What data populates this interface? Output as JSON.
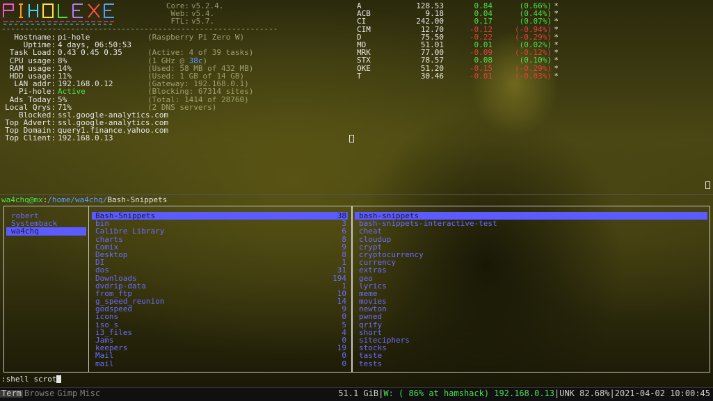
{
  "conky": {
    "logo_text": "PiHole",
    "versions": [
      {
        "label": "Core:",
        "value": "v5.2.4."
      },
      {
        "label": "Web:",
        "value": "v5.4."
      },
      {
        "label": "FTL:",
        "value": "v5.7."
      }
    ],
    "rule": "------------------------------------------------------------------",
    "rows": [
      {
        "key": "Hostname:",
        "value": "pi-hole",
        "note": "(Raspberry Pi Zero W)"
      },
      {
        "key": "Uptime:",
        "value": "4 days, 06:50:53",
        "note": ""
      },
      {
        "key": "Task Load:",
        "value": "0.43 0.45 0.35",
        "note": "(Active: 4 of 39 tasks)"
      },
      {
        "key": "CPU usage:",
        "value": "8%",
        "note_pre": "(1 GHz @ ",
        "note_hl": "38c",
        "note_post": ")"
      },
      {
        "key": "RAM usage:",
        "value": "14%",
        "note": "(Used: 58 MB of 432 MB)"
      },
      {
        "key": "HDD usage:",
        "value": "11%",
        "note": "(Used: 1 GB of 14 GB)"
      },
      {
        "key": "LAN addr:",
        "value": "192.168.0.12",
        "note": "(Gateway: 192.168.0.1)"
      },
      {
        "key": "Pi-hole:",
        "value": "Active",
        "note": "(Blocking: 67314 sites)"
      },
      {
        "key": "Ads Today:",
        "value": "5%",
        "note": "(Total: 1414 of 28760)"
      },
      {
        "key": "Local Qrys:",
        "value": "71%",
        "note": "(2 DNS servers)"
      },
      {
        "key": "Blocked:",
        "value": "ssl.google-analytics.com",
        "note": ""
      },
      {
        "key": "Top Advert:",
        "value": "ssl.google-analytics.com",
        "note": ""
      },
      {
        "key": "Top Domain:",
        "value": "query1.finance.yahoo.com",
        "note": ""
      },
      {
        "key": "Top Client:",
        "value": "192.168.0.13",
        "note": ""
      }
    ]
  },
  "stocks": [
    {
      "sym": "A",
      "price": "128.53",
      "chg": "0.84",
      "pct": "(0.66%)",
      "dir": "up"
    },
    {
      "sym": "ACB",
      "price": "9.18",
      "chg": "0.04",
      "pct": "(0.44%)",
      "dir": "up"
    },
    {
      "sym": "CI",
      "price": "242.00",
      "chg": "0.17",
      "pct": "(0.07%)",
      "dir": "up"
    },
    {
      "sym": "CIM",
      "price": "12.70",
      "chg": "-0.12",
      "pct": "(-0.94%)",
      "dir": "down"
    },
    {
      "sym": "D",
      "price": "75.50",
      "chg": "-0.22",
      "pct": "(-0.29%)",
      "dir": "down"
    },
    {
      "sym": "MO",
      "price": "51.01",
      "chg": "0.01",
      "pct": "(0.02%)",
      "dir": "up"
    },
    {
      "sym": "MRK",
      "price": "77.00",
      "chg": "-0.09",
      "pct": "(-0.12%)",
      "dir": "down"
    },
    {
      "sym": "STX",
      "price": "78.57",
      "chg": "0.08",
      "pct": "(0.10%)",
      "dir": "up"
    },
    {
      "sym": "OKE",
      "price": "51.20",
      "chg": "-0.15",
      "pct": "(-0.29%)",
      "dir": "down"
    },
    {
      "sym": "T",
      "price": "30.46",
      "chg": "-0.01",
      "pct": "(-0.03%)",
      "dir": "down"
    }
  ],
  "stock_star": "*",
  "terminal": {
    "prompt_user": "wa4chq@mx",
    "prompt_sep": ":",
    "prompt_path": "/home/wa4chq/",
    "prompt_dir": "Bash-Snippets",
    "left_pane": [
      "robert",
      "Systemback",
      "wa4chq"
    ],
    "left_selected": 2,
    "mid_pane": [
      {
        "name": "Bash-Snippets",
        "count": "38"
      },
      {
        "name": "bin",
        "count": "3"
      },
      {
        "name": "Calibre Library",
        "count": "6"
      },
      {
        "name": "charts",
        "count": "8"
      },
      {
        "name": "Comix",
        "count": "9"
      },
      {
        "name": "Desktop",
        "count": "8"
      },
      {
        "name": "DI",
        "count": "1"
      },
      {
        "name": "dos",
        "count": "31"
      },
      {
        "name": "Downloads",
        "count": "194"
      },
      {
        "name": "dvdrip-data",
        "count": "1"
      },
      {
        "name": "from_ftp",
        "count": "10"
      },
      {
        "name": "g_speed_reunion",
        "count": "14"
      },
      {
        "name": "godspeed",
        "count": "9"
      },
      {
        "name": "icons",
        "count": "0"
      },
      {
        "name": "iso_s",
        "count": "5"
      },
      {
        "name": "i3_files",
        "count": "4"
      },
      {
        "name": "Jams",
        "count": "0"
      },
      {
        "name": "keepers",
        "count": "19"
      },
      {
        "name": "Mail",
        "count": "0"
      },
      {
        "name": "mail",
        "count": "0"
      }
    ],
    "mid_selected": 0,
    "right_pane": [
      "bash-snippets",
      "bash-snippets-interactive-test",
      "cheat",
      "cloudup",
      "crypt",
      "cryptocurrency",
      "currency",
      "extras",
      "geo",
      "lyrics",
      "meme",
      "movies",
      "newton",
      "pwned",
      "qrify",
      "short",
      "siteciphers",
      "stocks",
      "taste",
      "tests"
    ],
    "right_selected": 0,
    "command": ":shell scrot"
  },
  "statusbar": {
    "tabs": [
      "Term",
      "Browse",
      "Gimp",
      "Misc"
    ],
    "active_tab": 0,
    "disk": "51.1 GiB",
    "wifi_prefix": "W: ( 86% at hamshack)",
    "wifi_ip": "192.168.0.13",
    "battery": "UNK 82.68%",
    "datetime": "2021-04-02 10:00:45",
    "sep": "|"
  },
  "colors": {
    "up": "#4ee04e",
    "down": "#e04040",
    "ranger_blue": "#6b6bff",
    "ranger_sel": "#5b5bff",
    "prompt_green": "#4ee04e",
    "prompt_path": "#5c9cff"
  }
}
